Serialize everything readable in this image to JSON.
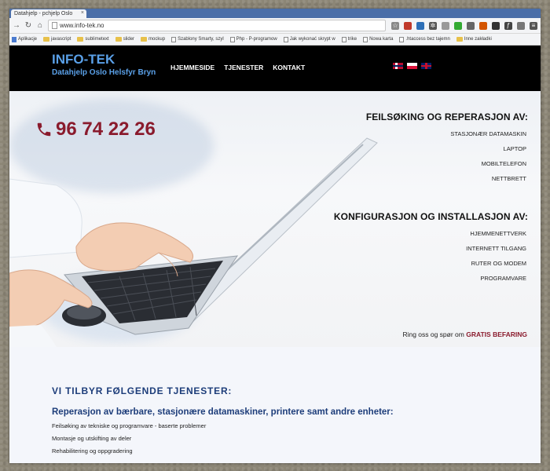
{
  "browser": {
    "tab_title": "Datahjelp - pchjelp Oslo",
    "url": "www.info-tek.no",
    "bookmarks": [
      {
        "label": "Aplikacje",
        "type": "apps"
      },
      {
        "label": "javascript",
        "type": "folder"
      },
      {
        "label": "sublimetext",
        "type": "folder"
      },
      {
        "label": "slider",
        "type": "folder"
      },
      {
        "label": "mockup",
        "type": "folder"
      },
      {
        "label": "Szablony Smarty, szyl",
        "type": "page"
      },
      {
        "label": "Php - P-programow",
        "type": "page"
      },
      {
        "label": "Jak wykonać skrypt w",
        "type": "page"
      },
      {
        "label": "trike",
        "type": "page"
      },
      {
        "label": "Nowa karta",
        "type": "page"
      },
      {
        "label": ".htaccess bez tajemn",
        "type": "page"
      },
      {
        "label": "Inne zakładki",
        "type": "folder"
      }
    ]
  },
  "site": {
    "logo_title": "INFO-TEK",
    "logo_sub": "Datahjelp Oslo Helsfyr Bryn",
    "nav": [
      "HJEMMESIDE",
      "TJENESTER",
      "KONTAKT"
    ],
    "phone": "96 74 22 26",
    "repair": {
      "heading": "FEILSØKING OG REPERASJON AV:",
      "items": [
        "STASJONÆR DATAMASKIN",
        "LAPTOP",
        "MOBILTELEFON",
        "NETTBRETT"
      ]
    },
    "config": {
      "heading": "KONFIGURASJON OG INSTALLASJON AV:",
      "items": [
        "HJEMMENETTVERK",
        "INTERNETT TILGANG",
        "RUTER OG MODEM",
        "PROGRAMVARE"
      ]
    },
    "cta_text": "Ring oss og spør om",
    "cta_highlight": "GRATIS BEFARING",
    "services_heading": "VI TILBYR FØLGENDE TJENESTER:",
    "services_sub": "Reperasjon av bærbare, stasjonære datamaskiner, printere samt andre enheter:",
    "services_items": [
      "Feilsøking av tekniske og programvare - baserte problemer",
      "Montasje og utskifting av deler",
      "Rehabilitering og oppgradering"
    ]
  },
  "colors": {
    "accent_blue": "#5aa0e8",
    "brand_red": "#8a1b2d",
    "heading_blue": "#1d3d7a"
  }
}
